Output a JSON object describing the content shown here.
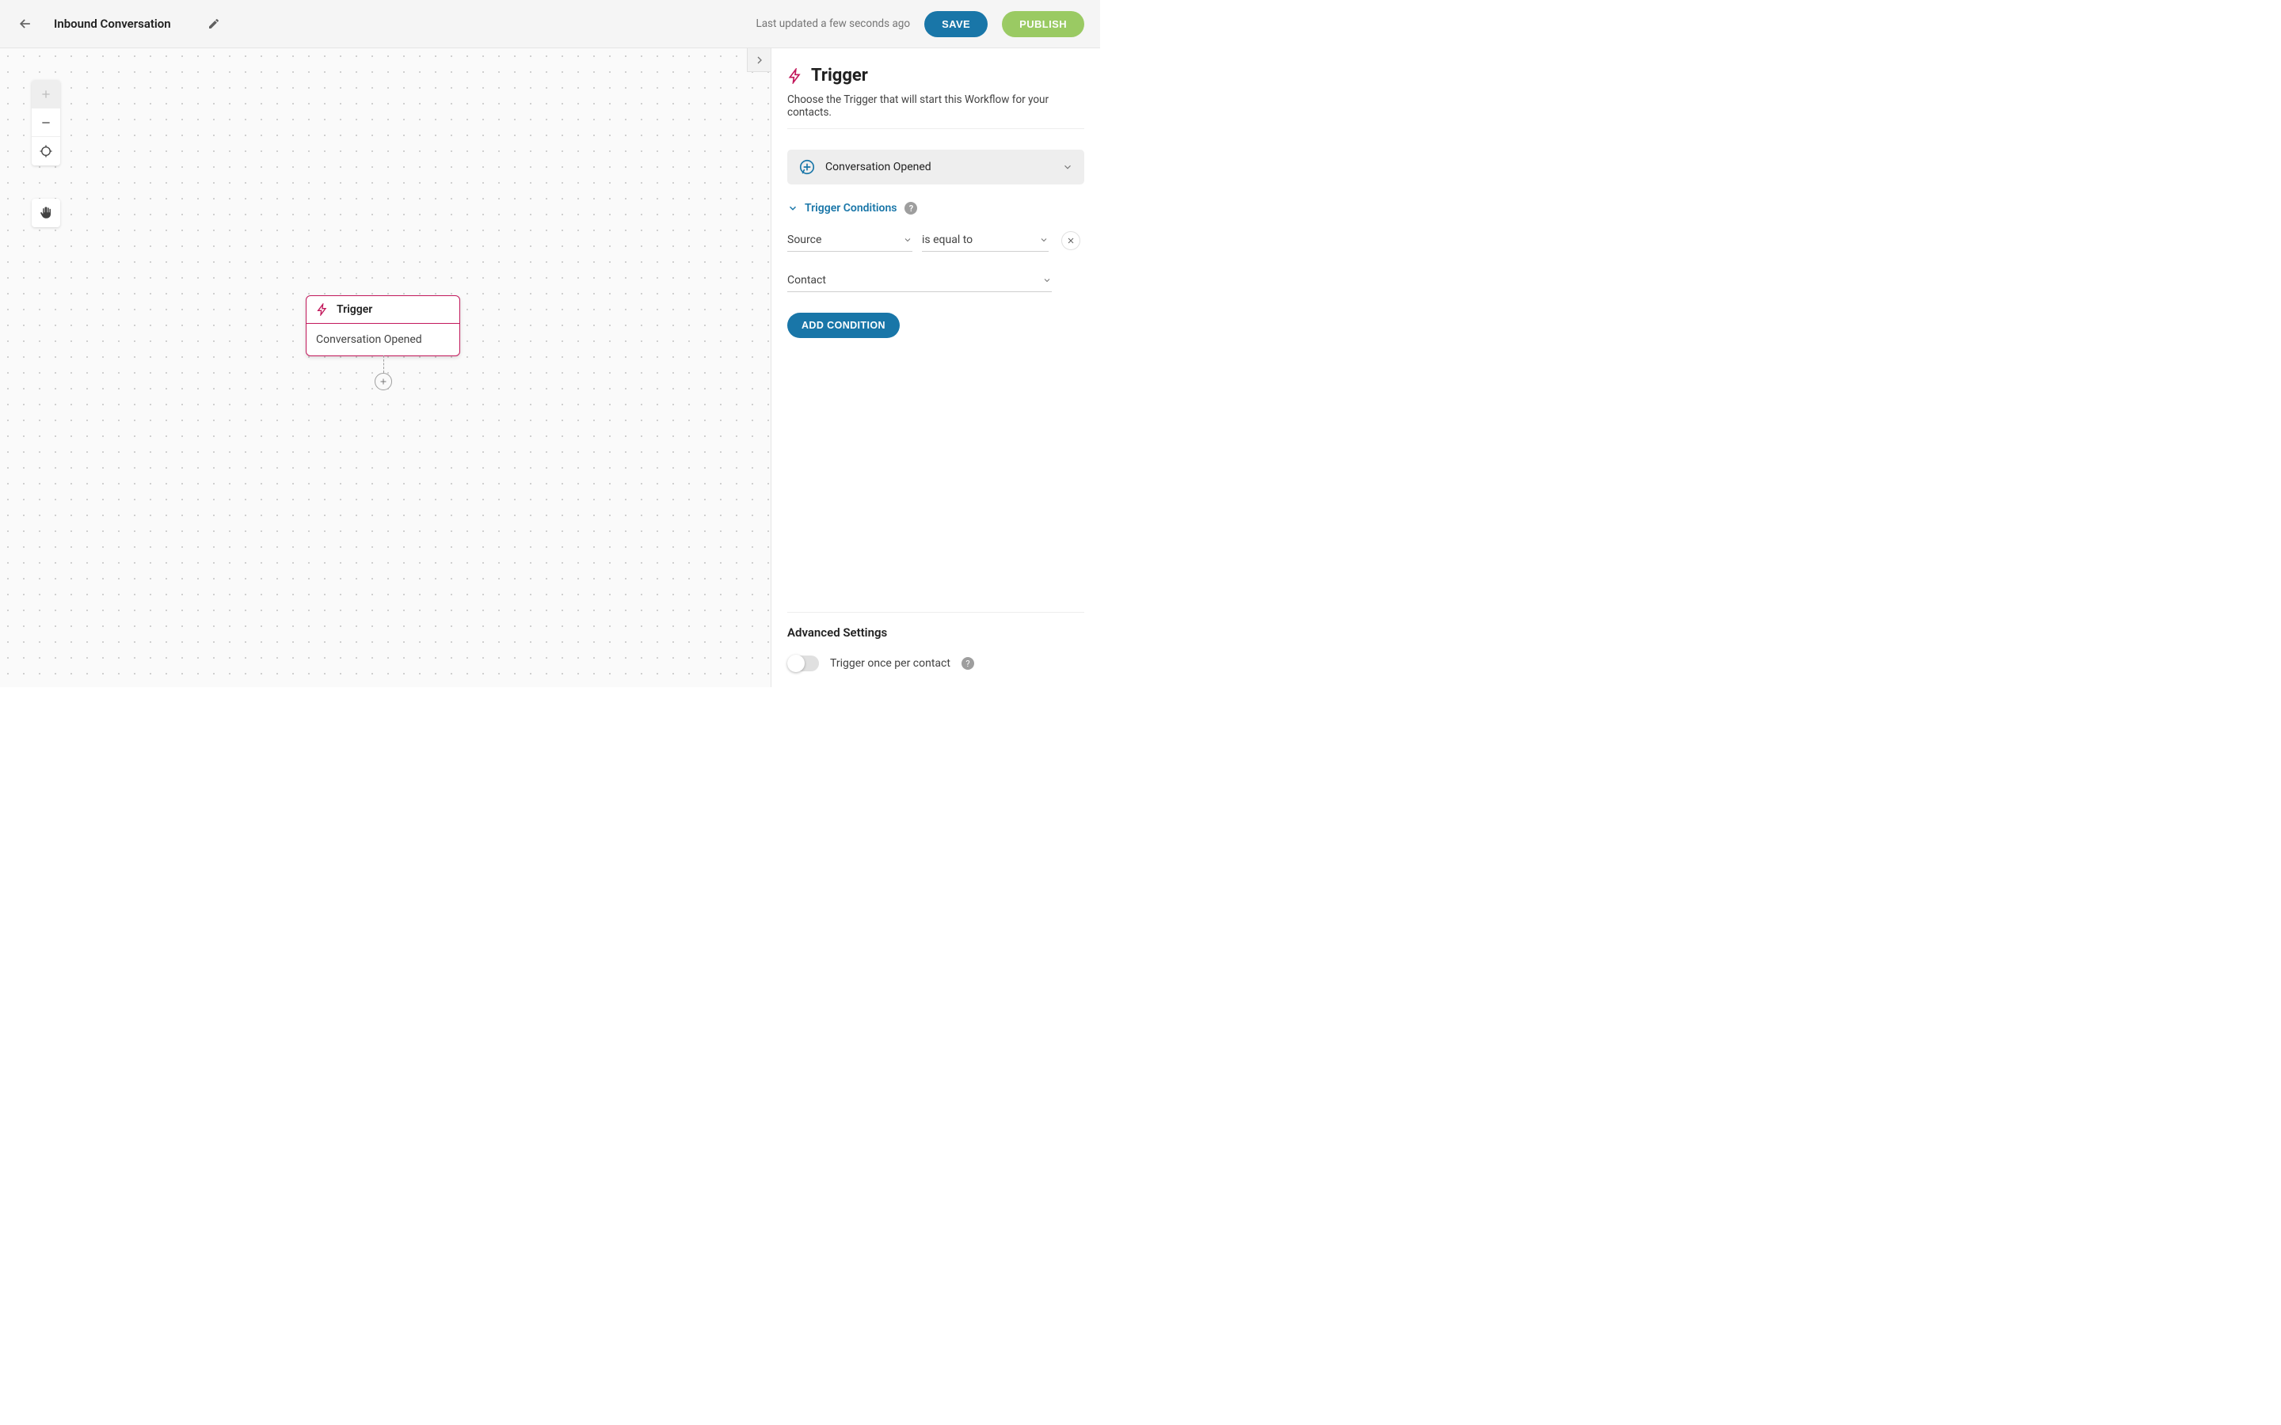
{
  "header": {
    "title": "Inbound Conversation",
    "last_updated": "Last updated a few seconds ago",
    "save_label": "SAVE",
    "publish_label": "PUBLISH"
  },
  "canvas": {
    "node": {
      "title": "Trigger",
      "body": "Conversation Opened"
    }
  },
  "panel": {
    "title": "Trigger",
    "description": "Choose the Trigger that will start this Workflow for your contacts.",
    "trigger_selected": "Conversation Opened",
    "conditions_section_label": "Trigger Conditions",
    "condition": {
      "field": "Source",
      "operator": "is equal to",
      "value": "Contact"
    },
    "add_condition_label": "ADD CONDITION",
    "advanced_settings_label": "Advanced Settings",
    "toggle_label": "Trigger once per contact"
  }
}
